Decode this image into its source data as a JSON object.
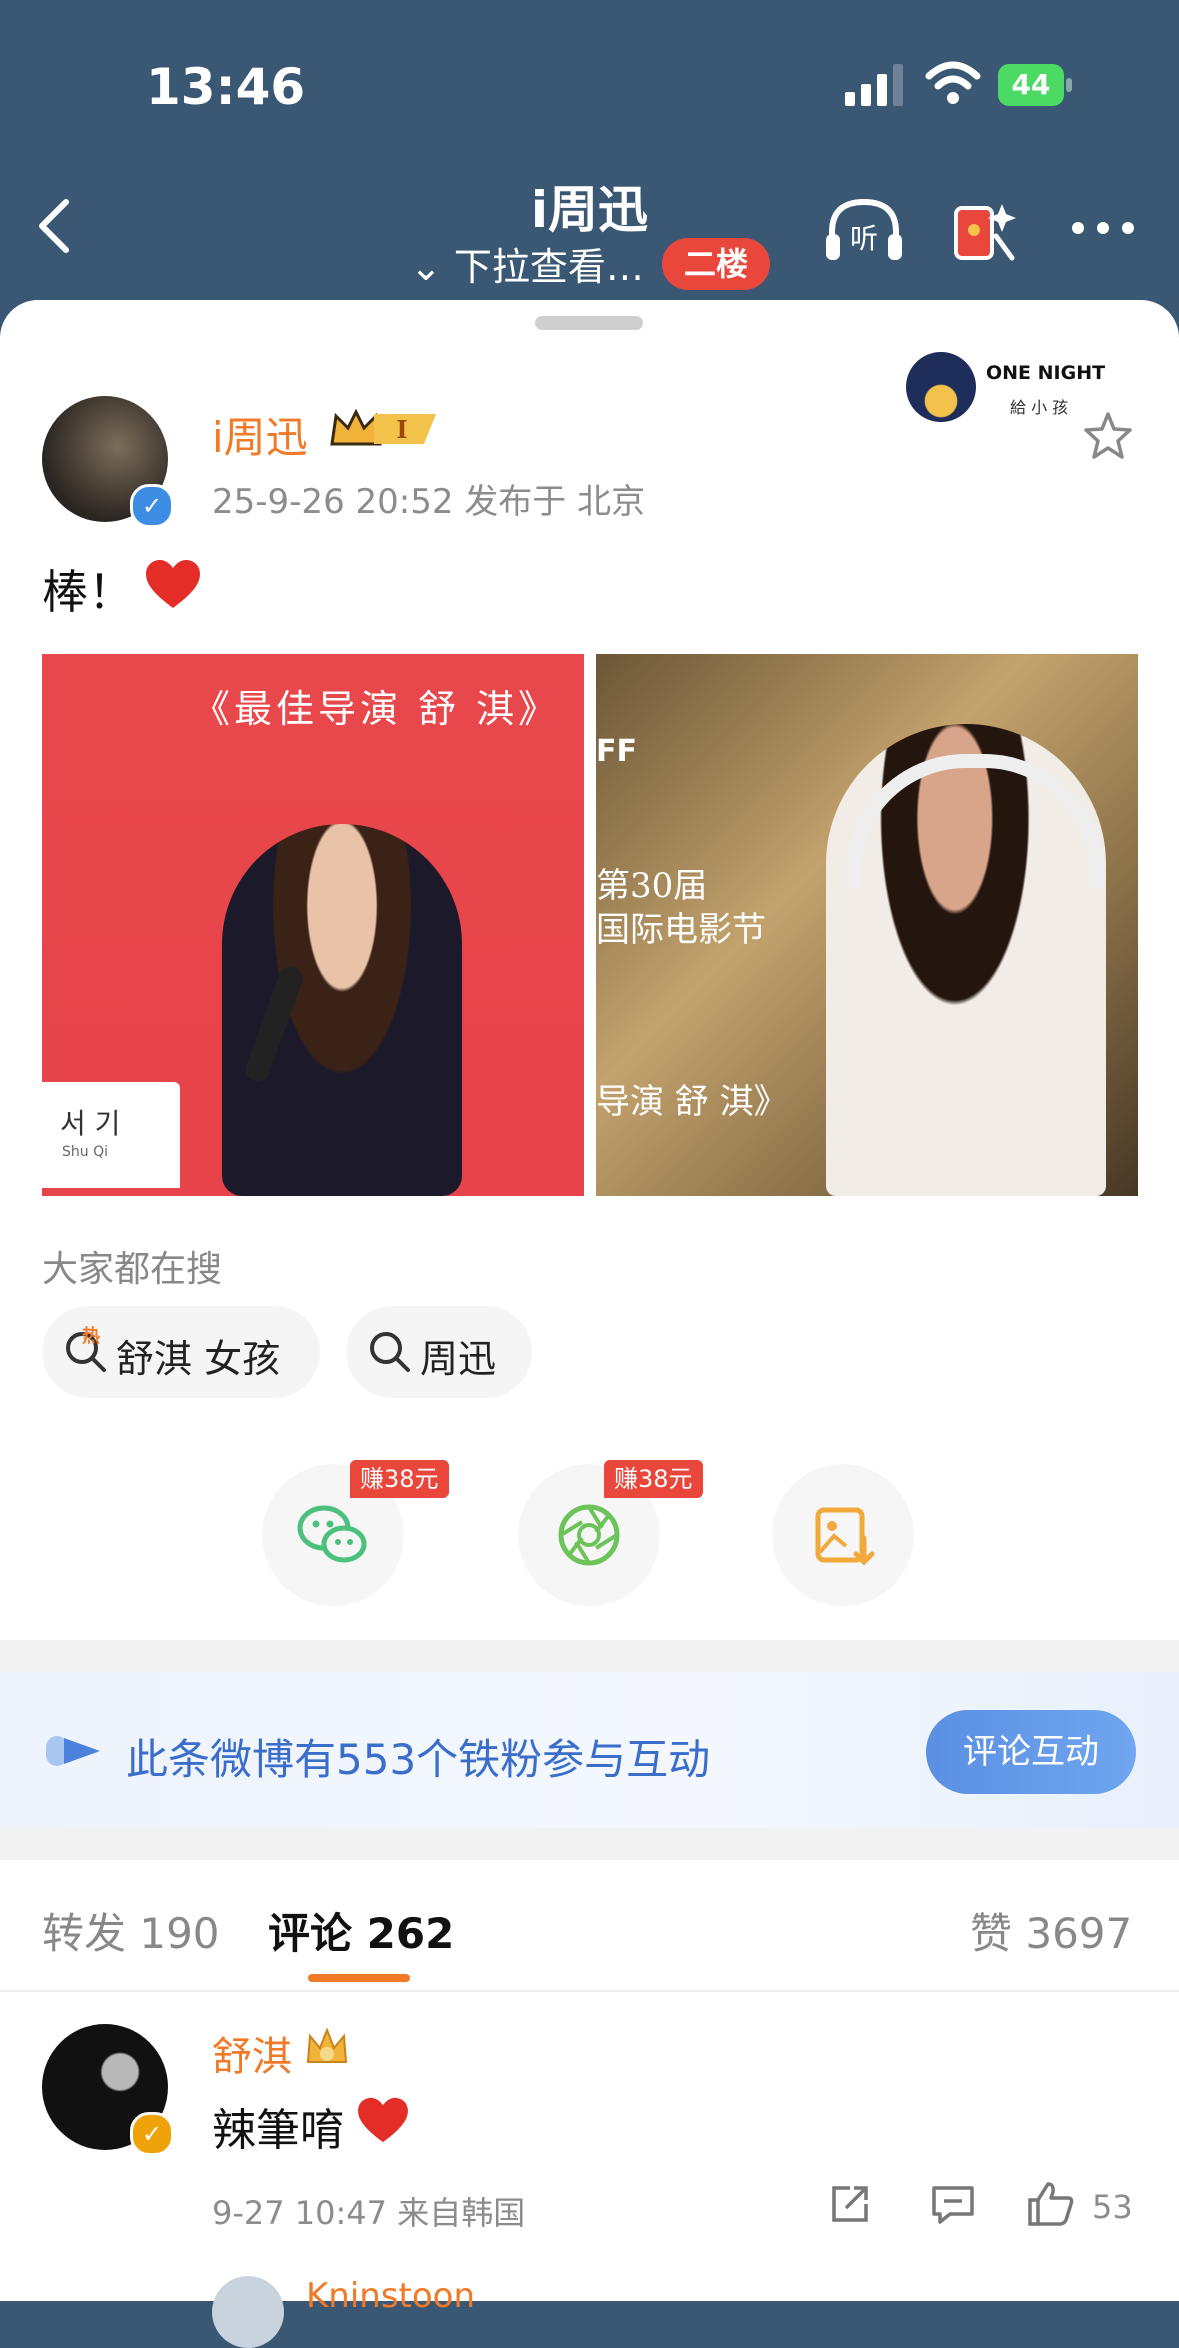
{
  "status_bar": {
    "time": "13:46",
    "battery": "44"
  },
  "nav": {
    "title": "i周迅",
    "subtitle": "下拉查看…",
    "badge": "二楼"
  },
  "author": {
    "name": "i周迅",
    "vip_level": "I",
    "meta": "25-9-26 20:52  发布于 北京"
  },
  "ad": {
    "title": "ONE NIGHT",
    "subtitle": "給 小 孩"
  },
  "post": {
    "text": "棒！"
  },
  "photos": {
    "photo_1": {
      "caption": "《最佳导演 舒 淇》",
      "nameplate": "서 기",
      "nameplate_sub": "Shu Qi"
    },
    "photo_2": {
      "logo": "FF",
      "caption_lines": "第30届\n国际电影节",
      "caption_bottom": "导演 舒 淇》"
    }
  },
  "search_section": {
    "label": "大家都在搜",
    "chips": [
      {
        "label": "舒淇 女孩",
        "hot": "热"
      },
      {
        "label": "周迅"
      }
    ]
  },
  "share": {
    "earn_1": "赚38元",
    "earn_2": "赚38元"
  },
  "fans_banner": {
    "text": "此条微博有553个铁粉参与互动",
    "button": "评论互动"
  },
  "tabs": {
    "repost": "转发 190",
    "comment": "评论 262",
    "like": "赞 3697"
  },
  "comment": {
    "name": "舒淇",
    "text": "辣筆唷",
    "meta": "9-27 10:47  来自韩国",
    "likes": "53"
  },
  "next_comment": {
    "name": "Kninstoon"
  }
}
